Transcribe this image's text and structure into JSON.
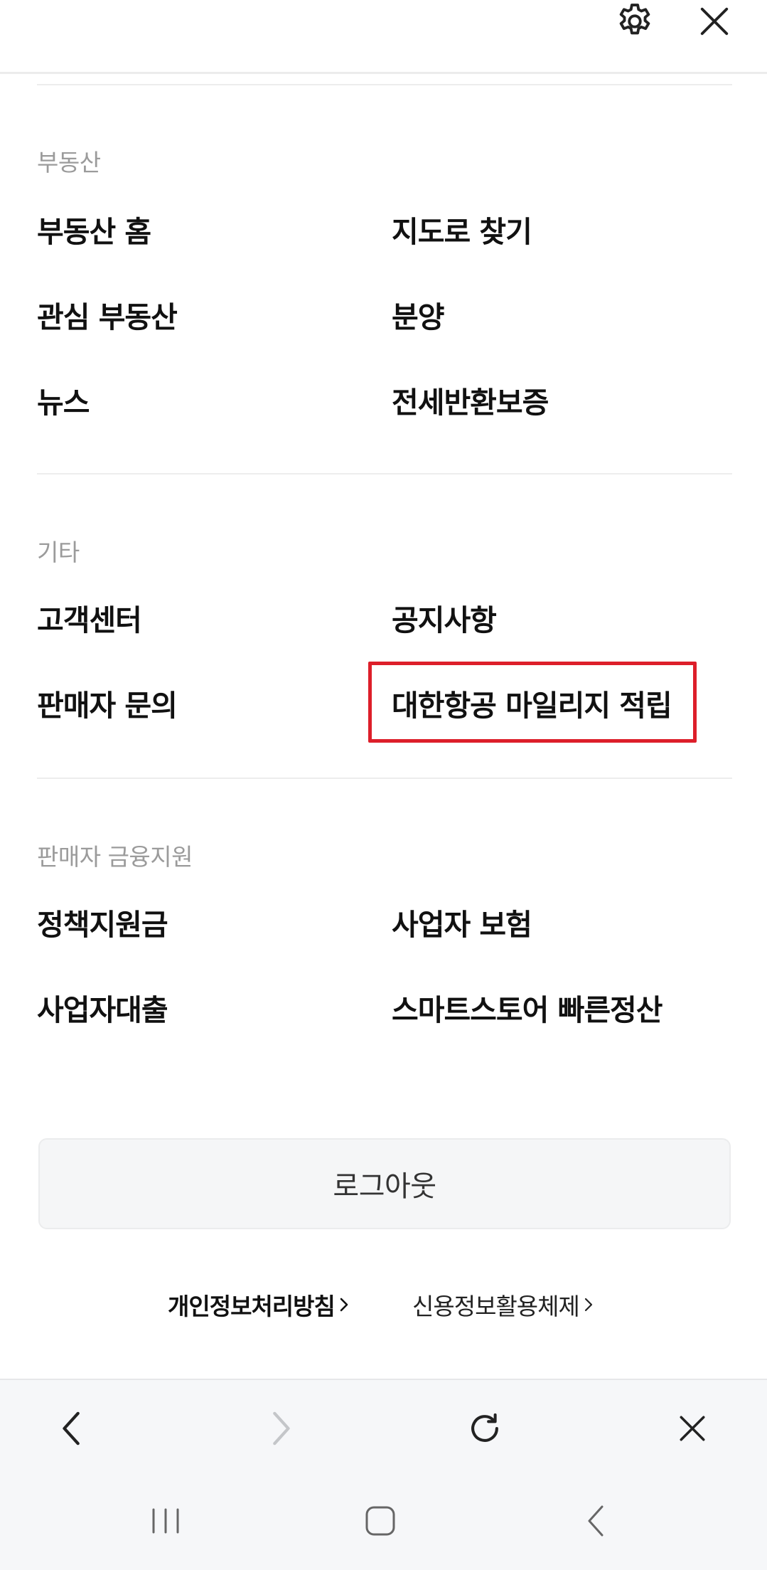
{
  "header": {
    "settings_icon": "gear-icon",
    "close_icon": "close-icon"
  },
  "sections": {
    "real_estate": {
      "title": "부동산",
      "items": [
        "부동산 홈",
        "지도로 찾기",
        "관심 부동산",
        "분양",
        "뉴스",
        "전세반환보증"
      ]
    },
    "etc": {
      "title": "기타",
      "items": [
        "고객센터",
        "공지사항",
        "판매자 문의",
        "대한항공 마일리지 적립"
      ]
    },
    "seller_finance": {
      "title": "판매자 금융지원",
      "items": [
        "정책지원금",
        "사업자 보험",
        "사업자대출",
        "스마트스토어 빠른정산"
      ]
    }
  },
  "logout_label": "로그아웃",
  "footer": {
    "privacy_label": "개인정보처리방침",
    "credit_label": "신용정보활용체제"
  },
  "colors": {
    "highlight": "#dd1f2a",
    "section_title": "#9b9b9b"
  }
}
